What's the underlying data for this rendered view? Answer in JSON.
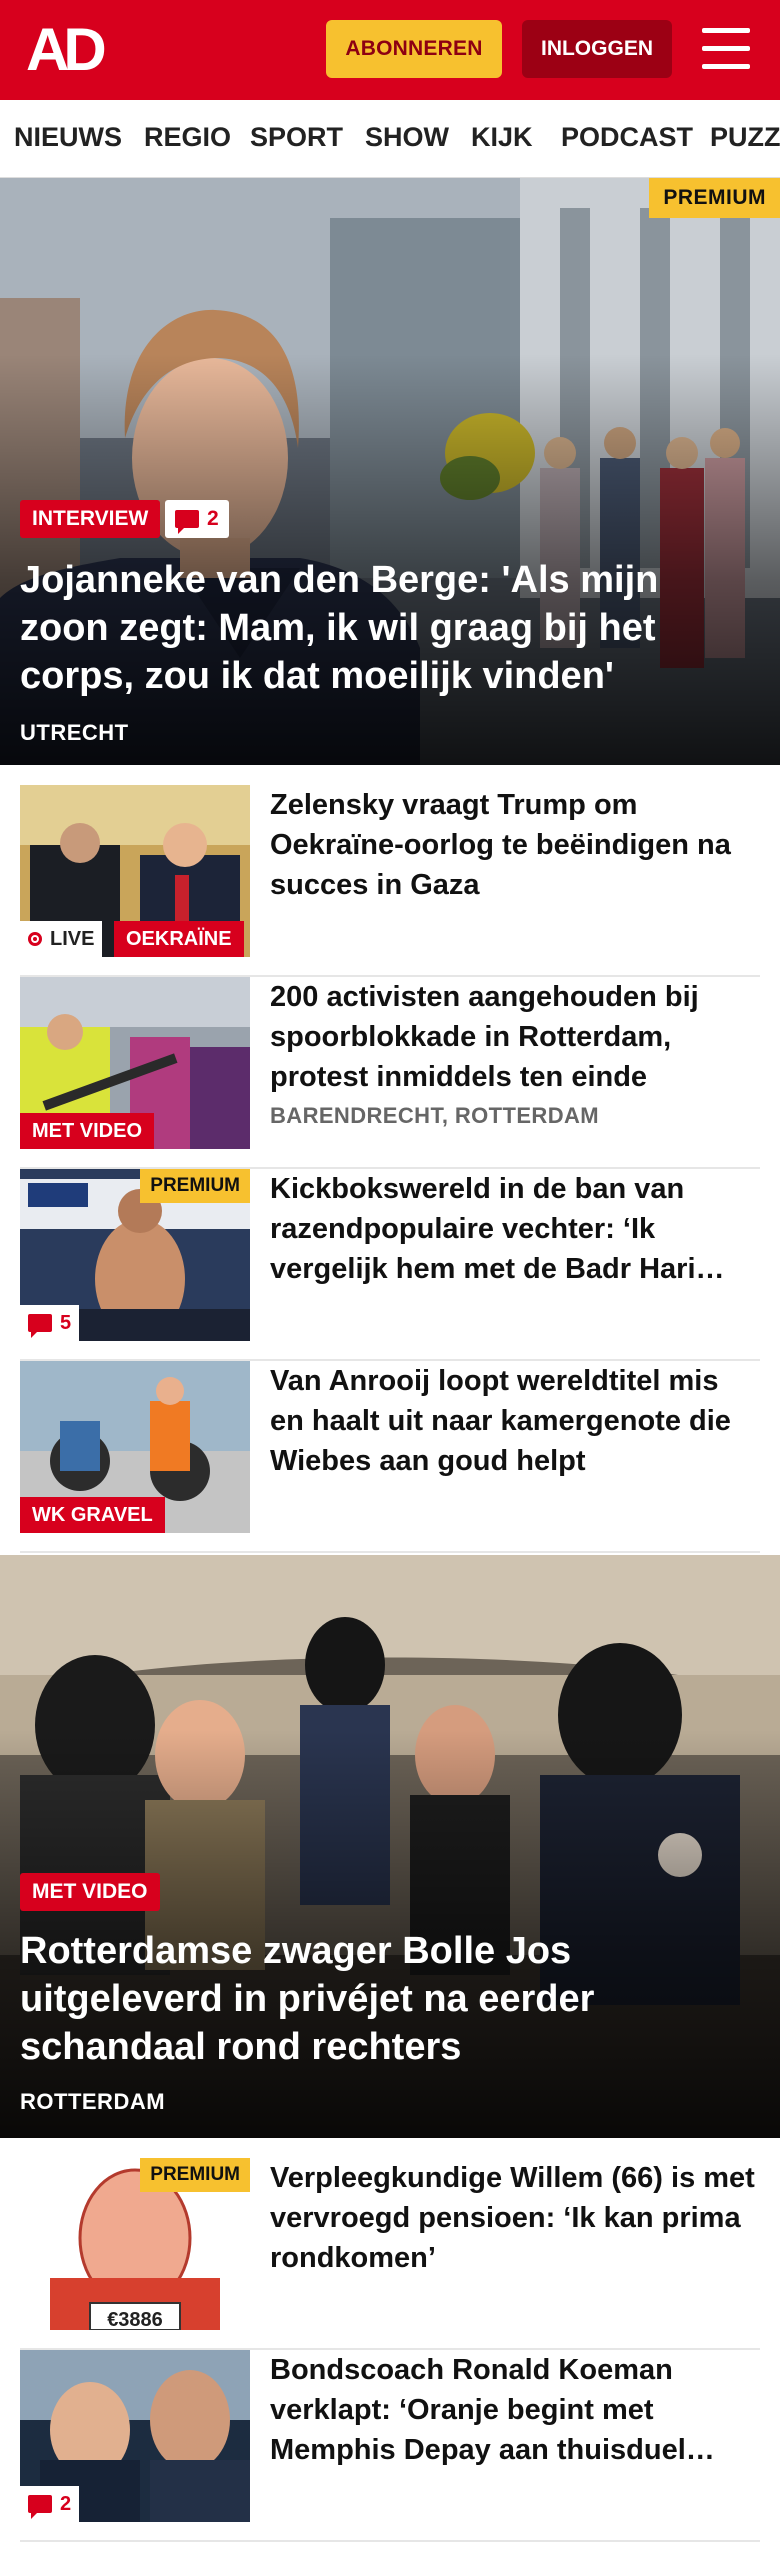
{
  "header": {
    "logo": "AD",
    "subscribe_label": "ABONNEREN",
    "login_label": "INLOGGEN"
  },
  "nav": {
    "items": [
      "NIEUWS",
      "REGIO",
      "SPORT",
      "SHOW",
      "KIJK",
      "PODCAST",
      "PUZZ"
    ]
  },
  "hero1": {
    "premium": "PREMIUM",
    "tag": "INTERVIEW",
    "comments": "2",
    "title": "Jojanneke van den Berge: 'Als mijn zoon zegt: Mam, ik wil graag bij het corps, zou ik dat moeilijk vinden'",
    "location": "UTRECHT"
  },
  "articles": [
    {
      "title": "Zelensky vraagt Trump om Oekraïne-oorlog te beëindigen na succes in Gaza",
      "live": "LIVE",
      "tag": "OEKRAÏNE"
    },
    {
      "title": "200 activisten aangehouden bij spoorblokkade in Rotterdam, protest inmiddels ten einde",
      "location": "BARENDRECHT, ROTTERDAM",
      "tag": "MET VIDEO"
    },
    {
      "title": "Kickbokswereld in de ban van razendpopulaire vechter: ‘Ik vergelijk hem met de Badr Hari…",
      "premium": "PREMIUM",
      "comments": "5"
    },
    {
      "title": "Van Anrooij loopt wereldtitel mis en haalt uit naar kamergenote die Wiebes aan goud helpt",
      "tag": "WK GRAVEL"
    }
  ],
  "hero2": {
    "tag": "MET VIDEO",
    "title": "Rotterdamse zwager Bolle Jos uitgeleverd in privéjet na eerder schandaal rond rechters",
    "location": "ROTTERDAM"
  },
  "articles2": [
    {
      "title": "Verpleegkundige Willem (66) is met vervroegd pensioen: ‘Ik kan prima rondkomen’",
      "premium": "PREMIUM",
      "sign_number": "€3886"
    },
    {
      "title": "Bondscoach Ronald Koeman verklapt: ‘Oranje begint met Memphis Depay aan thuisduel…",
      "comments": "2"
    }
  ],
  "colors": {
    "brand_red": "#d7001d",
    "premium_yellow": "#f7c12f",
    "login_dark_red": "#9c0014"
  }
}
